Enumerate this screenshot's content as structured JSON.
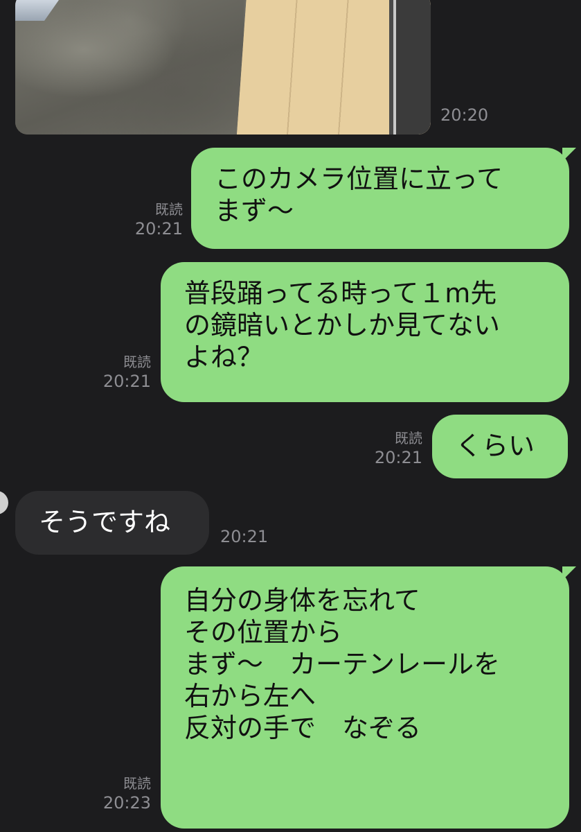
{
  "messages": [
    {
      "id": "photo",
      "time": "20:20"
    },
    {
      "id": "m1",
      "text": "このカメラ位置に立って\nまず〜",
      "read": "既読",
      "time": "20:21"
    },
    {
      "id": "m2",
      "text": "普段踊ってる時って１m先\nの鏡暗いとかしか見てない\nよね？",
      "read": "既読",
      "time": "20:21"
    },
    {
      "id": "m3",
      "text": "くらい",
      "read": "既読",
      "time": "20:21"
    },
    {
      "id": "m4",
      "text": "そうですね",
      "time": "20:21"
    },
    {
      "id": "m5",
      "text": "自分の身体を忘れて\nその位置から\nまず〜　カーテンレールを\n右から左へ\n反対の手で　なぞる",
      "read": "既読",
      "time": "20:23"
    }
  ],
  "colors": {
    "outgoing": "#8fdc82",
    "incoming": "#2c2c2e",
    "background": "#1c1c1e"
  }
}
